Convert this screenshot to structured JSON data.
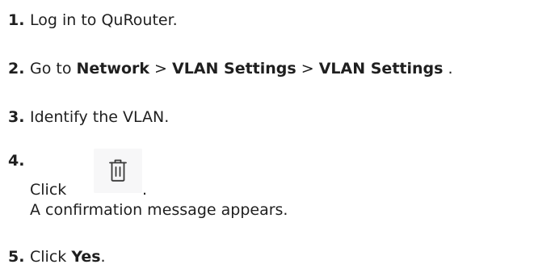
{
  "steps": [
    {
      "number": "1.",
      "text": "Log in to QuRouter."
    },
    {
      "number": "2.",
      "prefix": "Go to ",
      "menu1": "Network",
      "sep1": " > ",
      "menu2": "VLAN Settings",
      "sep2": " > ",
      "menu3": "VLAN Settings",
      "suffix": " ."
    },
    {
      "number": "3.",
      "text": "Identify the VLAN."
    },
    {
      "number": "4.",
      "click_label": "Click",
      "icon": "trash-icon",
      "after_icon": ".",
      "result": "A confirmation message appears."
    },
    {
      "number": "5.",
      "prefix": "Click ",
      "button": "Yes",
      "suffix": "."
    }
  ]
}
